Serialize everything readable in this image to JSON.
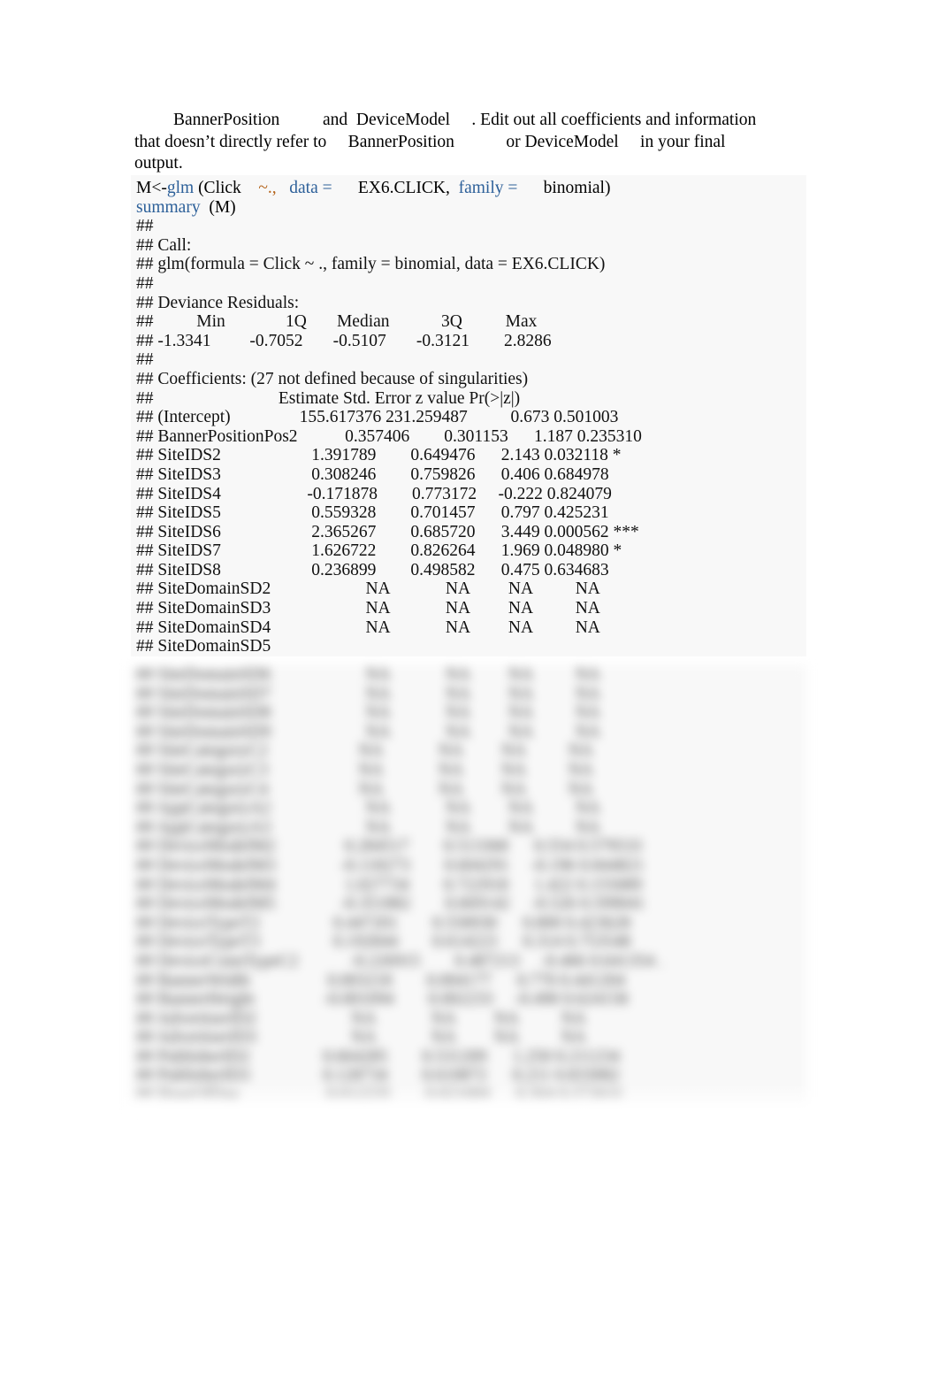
{
  "document": {
    "background_color": "#ffffff",
    "code_block_background": "#f8f8f8",
    "keyword_color": "#2d6099",
    "operator_color": "#b5651d"
  },
  "intro_paragraph": {
    "lines": [
      "BannerPosition          and  DeviceModel     . Edit out all coefficients and information",
      "that doesn’t directly refer to     BannerPosition            or DeviceModel     in your final",
      "output."
    ]
  },
  "source_code": {
    "line1": {
      "seg1": "M<-",
      "seg2": "glm",
      "seg3": " (Click    ",
      "seg4": "~.,",
      "seg5": "   ",
      "seg6": "data = ",
      "seg7": "     EX6.CLICK,  ",
      "seg8": "family = ",
      "seg9": "     binomial)"
    },
    "line2": {
      "seg1": "summary",
      "seg2": "  (M)"
    }
  },
  "console_output": {
    "lines": [
      "## ",
      "## Call:",
      "## glm(formula = Click ~ ., family = binomial, data = EX6.CLICK)",
      "## ",
      "## Deviance Residuals:",
      "##          Min              1Q       Median            3Q          Max",
      "## -1.3341         -0.7052       -0.5107       -0.3121        2.8286",
      "## ",
      "## Coefficients: (27 not defined because of singularities)",
      "##                             Estimate Std. Error z value Pr(>|z|)",
      "## (Intercept)                155.617376 231.259487          0.673 0.501003",
      "## BannerPositionPos2           0.357406        0.301153      1.187 0.235310",
      "## SiteIDS2                     1.391789        0.649476      2.143 0.032118 *",
      "## SiteIDS3                     0.308246        0.759826      0.406 0.684978",
      "## SiteIDS4                    -0.171878        0.773172     -0.222 0.824079",
      "## SiteIDS5                     0.559328        0.701457      0.797 0.425231",
      "## SiteIDS6                     2.365267        0.685720      3.449 0.000562 ***",
      "## SiteIDS7                     1.626722        0.826264      1.969 0.048980 *",
      "## SiteIDS8                     0.236899        0.498582      0.475 0.634683",
      "## SiteDomainSD2                      NA             NA         NA          NA",
      "## SiteDomainSD3                      NA             NA         NA          NA",
      "## SiteDomainSD4                      NA             NA         NA          NA",
      "## SiteDomainSD5"
    ]
  },
  "redacted_output": {
    "note": "blurred / unreadable continuation of the coefficient table",
    "lines": [
      "## SiteDomainSD6                      NA             NA         NA          NA",
      "## SiteDomainSD7                      NA             NA         NA          NA",
      "## SiteDomainSD8                      NA             NA         NA          NA",
      "## SiteDomainSD9                      NA             NA         NA          NA",
      "## SiteCategoryC2                     NA             NA         NA          NA",
      "## SiteCategoryC3                     NA             NA         NA          NA",
      "## SiteCategoryC4                     NA             NA         NA          NA",
      "## AppCategoryA2                      NA             NA         NA          NA",
      "## AppCategoryA3                      NA             NA         NA          NA",
      "## DeviceModelM2                0.284517        0.513368      0.554 0.579533",
      "## DeviceModelM3               -0.118273        0.604291     -0.196 0.844821",
      "## DeviceModelM4                1.027734        0.722918      1.422 0.155089",
      "## DeviceModelM5               -0.351882        0.669142     -0.526 0.599041",
      "## DeviceTypeT2                 0.447201        0.558930      0.800 0.423628",
      "## DeviceTypeT3                 0.192844        0.614223      0.314 0.753548",
      "## DeviceConnTypeC2            -0.226915        0.487213     -0.466 0.641354 .",
      "## BannerWidth                  0.003218        0.004177      0.770 0.441204",
      "## BannerHeight                -0.001094        0.002233     -0.490 0.624158",
      "## AdvertiserID2                      NA             NA         NA          NA",
      "## AdvertiserID3                      NA             NA         NA          NA",
      "## PublisherID2                 0.664285        0.531209      1.250 0.211234",
      "## PublisherID3                 0.128734        0.610872      0.211 0.833082",
      "## HourOfDay                    0.012235        0.021684      0.564 0.572631"
    ]
  }
}
